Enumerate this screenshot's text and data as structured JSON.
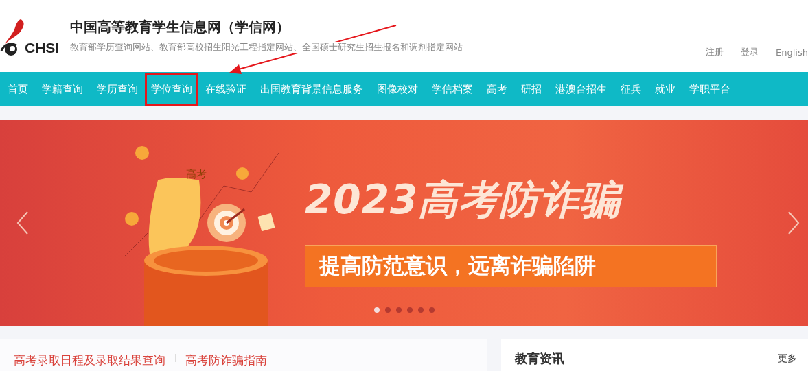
{
  "header": {
    "logo_text": "CHSI",
    "title": "中国高等教育学生信息网（学信网）",
    "subtitle": "教育部学历查询网站、教育部高校招生阳光工程指定网站、全国硕士研究生招生报名和调剂指定网站",
    "links": [
      "注册",
      "登录",
      "English"
    ]
  },
  "nav": [
    {
      "label": "首页",
      "highlighted": false
    },
    {
      "label": "学籍查询",
      "highlighted": false
    },
    {
      "label": "学历查询",
      "highlighted": false
    },
    {
      "label": "学位查询",
      "highlighted": true
    },
    {
      "label": "在线验证",
      "highlighted": false
    },
    {
      "label": "出国教育背景信息服务",
      "highlighted": false
    },
    {
      "label": "图像校对",
      "highlighted": false
    },
    {
      "label": "学信档案",
      "highlighted": false
    },
    {
      "label": "高考",
      "highlighted": false
    },
    {
      "label": "研招",
      "highlighted": false
    },
    {
      "label": "港澳台招生",
      "highlighted": false
    },
    {
      "label": "征兵",
      "highlighted": false
    },
    {
      "label": "就业",
      "highlighted": false
    },
    {
      "label": "学职平台",
      "highlighted": false
    }
  ],
  "banner": {
    "shield_text": "高考",
    "headline": "2023高考防诈骗",
    "tagline": "提高防范意识，远离诈骗陷阱",
    "dots": [
      {
        "selected": true
      },
      {
        "selected": false
      },
      {
        "selected": false
      },
      {
        "selected": false
      },
      {
        "selected": false
      },
      {
        "selected": false
      }
    ]
  },
  "left_card": {
    "links": [
      "高考录取日程及录取结果查询",
      "高考防诈骗指南"
    ]
  },
  "right_card": {
    "title": "教育资讯",
    "more": "更多"
  }
}
